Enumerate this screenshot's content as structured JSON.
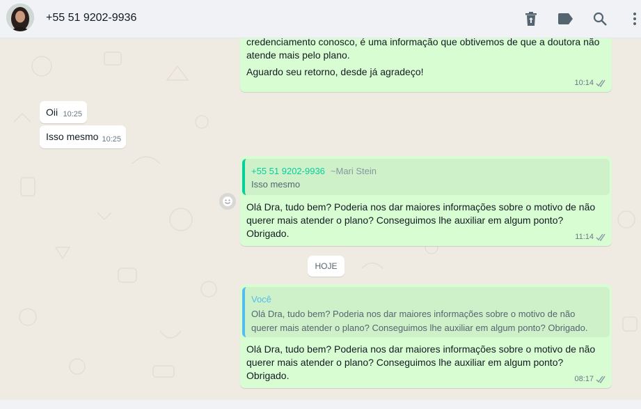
{
  "header": {
    "contact_name": "+55 51 9202-9936",
    "icons": [
      "trash-icon",
      "label-icon",
      "search-icon",
      "menu-icon"
    ]
  },
  "messages": [
    {
      "direction": "outgoing",
      "text_line1": "credenciamento conosco, é uma informação que obtivemos de que a doutora não",
      "text_line2": "atende mais pelo plano.",
      "text_line3": "Aguardo seu retorno, desde já agradeço!",
      "time": "10:14",
      "status": "read"
    },
    {
      "direction": "incoming",
      "text": "Oii",
      "time": "10:25"
    },
    {
      "direction": "incoming",
      "text": "Isso mesmo",
      "time": "10:25"
    },
    {
      "direction": "outgoing",
      "quote": {
        "author": "+55 51 9202-9936",
        "push_name": "~Mari Stein",
        "text": "Isso mesmo"
      },
      "text": "Olá Dra, tudo bem? Poderia nos dar maiores informações sobre o motivo de não\nquerer mais atender o plano? Conseguimos lhe auxiliar em algum ponto?\nObrigado.",
      "time": "11:14",
      "status": "read"
    },
    {
      "direction": "outgoing",
      "quote": {
        "author": "Você",
        "text": "Olá Dra, tudo bem? Poderia nos dar maiores informações sobre o motivo de não\nquerer mais atender o plano? Conseguimos lhe auxiliar em algum ponto? Obrigado."
      },
      "text": "Olá Dra, tudo bem? Poderia nos dar maiores informações sobre o motivo de não\nquerer mais atender o plano? Conseguimos lhe auxiliar em algum ponto?\nObrigado.",
      "time": "08:17",
      "status": "read"
    }
  ],
  "day_separator": "HOJE",
  "colors": {
    "outgoing_bubble": "#d9fdd3",
    "incoming_bubble": "#ffffff",
    "quote_contact": "#06cf9c",
    "quote_self": "#53bdeb",
    "read_ticks": "#8696a0"
  }
}
